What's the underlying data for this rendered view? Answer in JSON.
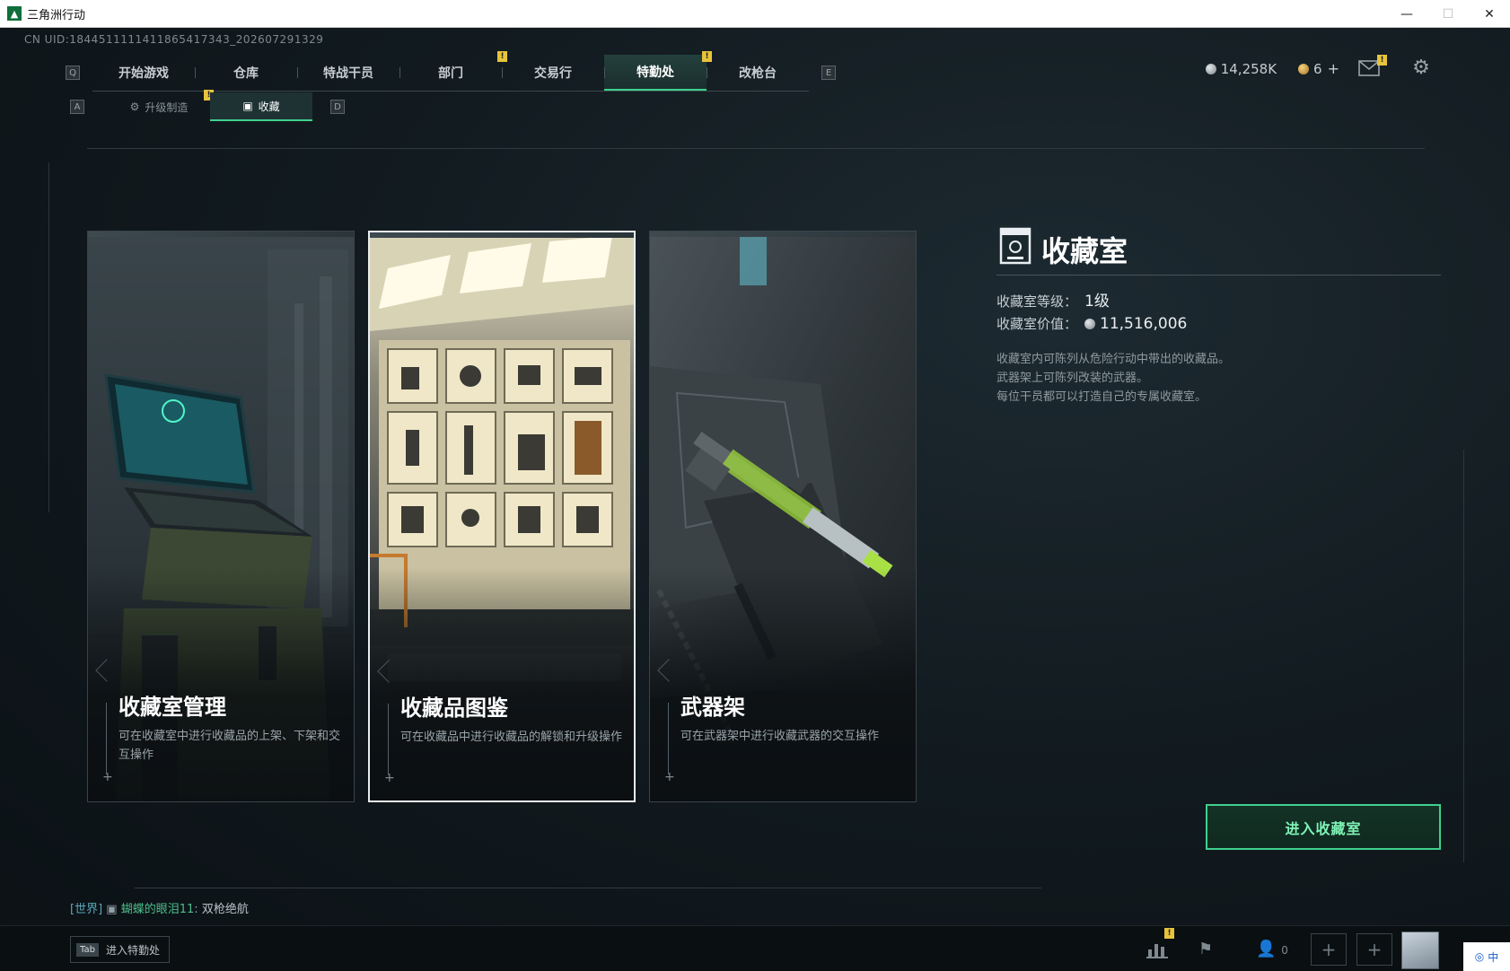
{
  "window": {
    "title": "三角洲行动",
    "minimize": "—",
    "maximize": "☐",
    "close": "✕"
  },
  "uid": "CN UID:1844511111411865417343_202607291329",
  "nav": {
    "left_key": "Q",
    "right_key": "E",
    "tabs": [
      {
        "label": "开始游戏"
      },
      {
        "label": "仓库"
      },
      {
        "label": "特战干员"
      },
      {
        "label": "部门",
        "badge": "!"
      },
      {
        "label": "交易行"
      },
      {
        "label": "特勤处",
        "badge": "!",
        "active": true
      },
      {
        "label": "改枪台"
      }
    ]
  },
  "currency": {
    "silver": "14,258K",
    "gold": "6",
    "gold_plus": "+"
  },
  "mail_badge": "!",
  "subnav": {
    "left_key": "A",
    "right_key": "D",
    "tabs": [
      {
        "label": "升级制造",
        "badge": "!"
      },
      {
        "label": "收藏",
        "active": true
      }
    ]
  },
  "cards": [
    {
      "title": "收藏室管理",
      "desc": "可在收藏室中进行收藏品的上架、下架和交互操作"
    },
    {
      "title": "收藏品图鉴",
      "desc": "可在收藏品中进行收藏品的解锁和升级操作"
    },
    {
      "title": "武器架",
      "desc": "可在武器架中进行收藏武器的交互操作"
    }
  ],
  "info": {
    "title": "收藏室",
    "level_label": "收藏室等级：",
    "level_value": "1级",
    "value_label": "收藏室价值：",
    "value_value": "11,516,006",
    "desc_lines": [
      "收藏室内可陈列从危险行动中带出的收藏品。",
      "武器架上可陈列改装的武器。",
      "每位干员都可以打造自己的专属收藏室。"
    ]
  },
  "enter_button": "进入收藏室",
  "chat": {
    "channel": "[世界]",
    "sender": "蝴蝶的眼泪11",
    "separator": ":",
    "message": "双枪绝航"
  },
  "bottom": {
    "tab_key": "Tab",
    "tab_label": "进入特勤处",
    "friends_count": "0",
    "stats_badge": "!",
    "slot_plus": "+"
  },
  "ime": "中",
  "colors": {
    "accent": "#3fd18e",
    "badge": "#e7c33c"
  }
}
